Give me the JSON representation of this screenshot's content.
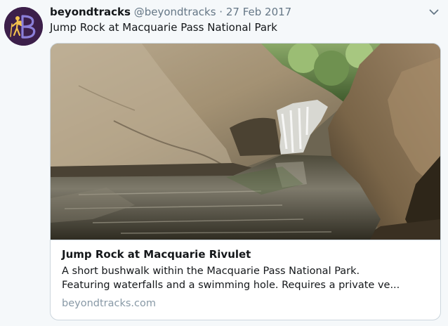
{
  "tweet": {
    "display_name": "beyondtracks",
    "handle": "@beyondtracks",
    "separator": "·",
    "date": "27 Feb 2017",
    "text": "Jump Rock at Macquarie Pass National Park",
    "avatar_icon": "hiker-logo-icon",
    "menu_icon": "chevron-down-icon"
  },
  "card": {
    "image_description_icon": "waterfall-photo",
    "title": "Jump Rock at Macquarie Rivulet",
    "description_line1": "A short bushwalk within the Macquarie Pass National Park.",
    "description_line2": "Featuring waterfalls and a swimming hole. Requires a private ve...",
    "domain": "beyondtracks.com"
  },
  "colors": {
    "background": "#f5f8fa",
    "text": "#14171a",
    "secondary_text": "#657786",
    "domain_text": "#8899a6",
    "border": "#ccd6dd",
    "avatar_bg": "#3c1f4a",
    "avatar_accent": "#f2c14e",
    "avatar_b": "#8b7fd9"
  }
}
